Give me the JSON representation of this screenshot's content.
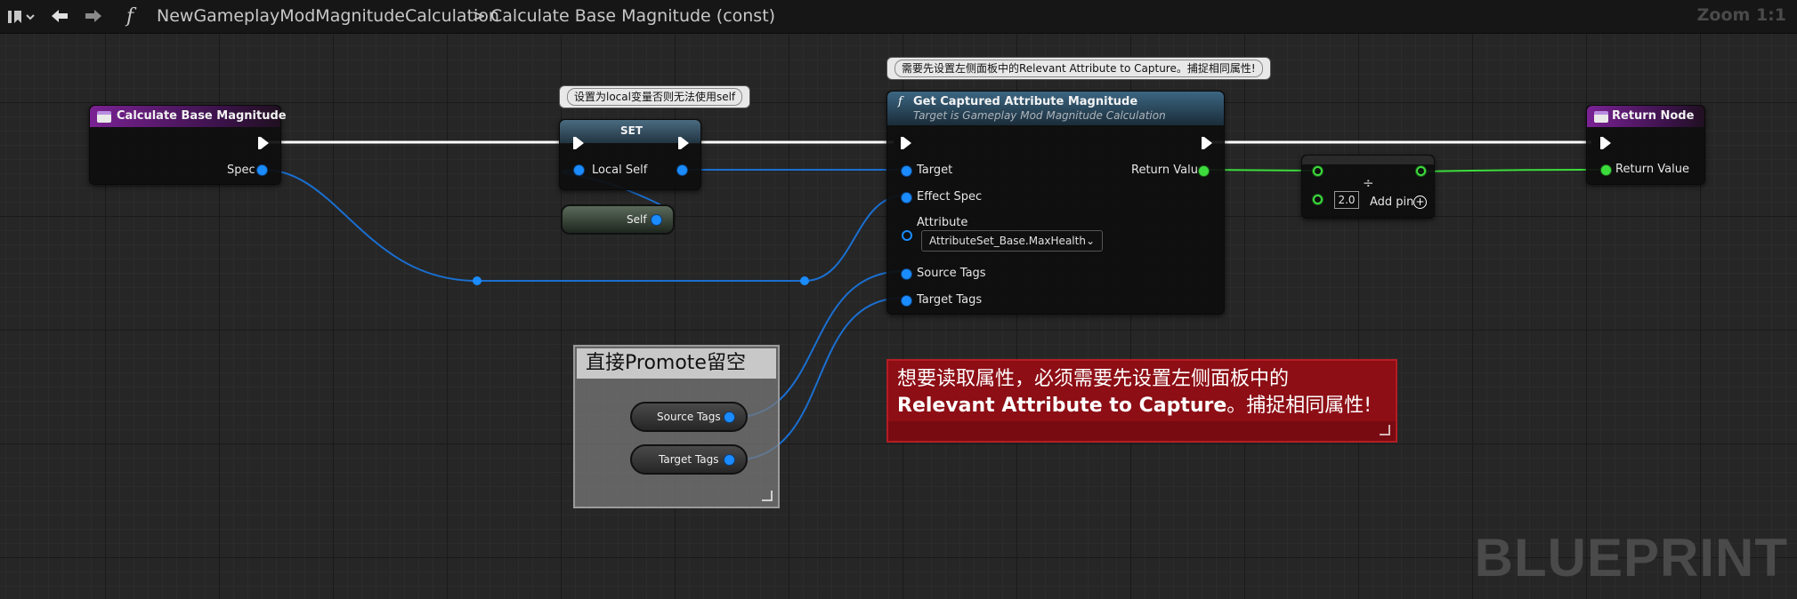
{
  "toolbar": {
    "function_glyph": "f",
    "breadcrumb_root": "NewGameplayModMagnitudeCalculation",
    "breadcrumb_sep": ">",
    "breadcrumb_current": "Calculate Base Magnitude (const)",
    "zoom": "Zoom 1:1"
  },
  "watermark": "BLUEPRINT",
  "nodes": {
    "entry": {
      "title": "Calculate Base Magnitude",
      "pin_spec": "Spec"
    },
    "set": {
      "title": "SET",
      "pin_local_self": "Local Self"
    },
    "self": {
      "label": "Self"
    },
    "get": {
      "title": "Get Captured Attribute Magnitude",
      "subtitle": "Target is Gameplay Mod Magnitude Calculation",
      "pin_target": "Target",
      "pin_effect_spec": "Effect Spec",
      "pin_attribute": "Attribute",
      "attribute_value": "AttributeSet_Base.MaxHealth",
      "pin_source_tags": "Source Tags",
      "pin_target_tags": "Target Tags",
      "pin_return": "Return Value"
    },
    "divide": {
      "symbol": "÷",
      "value": "2.0",
      "add_pin": "Add pin"
    },
    "return": {
      "title": "Return Node",
      "pin_return": "Return Value"
    }
  },
  "bubbles": {
    "set_note": "设置为local变量否则无法使用self",
    "get_note": "需要先设置左侧面板中的Relevant Attribute to Capture。捕捉相同属性!"
  },
  "comments": {
    "promote": {
      "title": "直接Promote留空",
      "source_tags": "Source Tags",
      "target_tags": "Target Tags"
    },
    "red": {
      "line1": "想要读取属性，必须需要先设置左侧面板中的",
      "line2_bold": "Relevant Attribute to Capture",
      "line2_rest": "。捕捉相同属性!"
    }
  },
  "colors": {
    "background": "#262626",
    "exec_wire": "#ffffff",
    "object_wire": "#1a8cff",
    "float_wire": "#3ddc3d",
    "function_header": "#26455e",
    "entry_header": "#6a1c7f",
    "comment_red": "#8d0e15",
    "comment_grey": "#787878"
  }
}
